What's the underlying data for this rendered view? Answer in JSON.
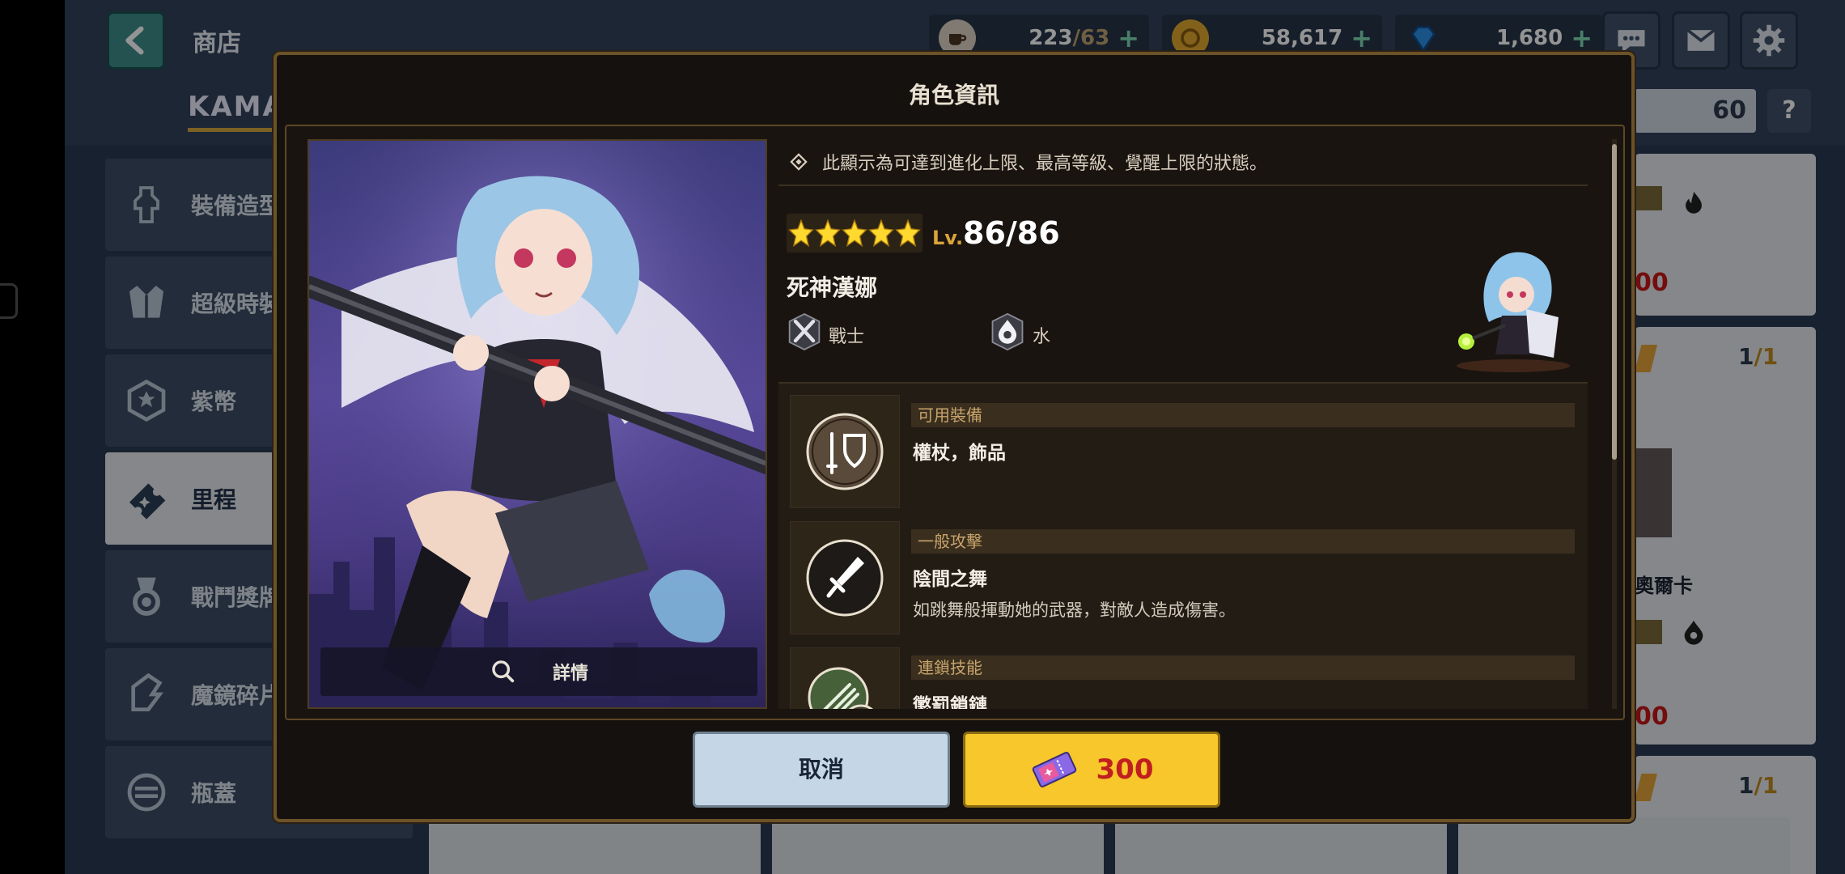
{
  "header": {
    "title": "商店",
    "tab_label": "KAMAZ",
    "ticket_count": "60",
    "help_label": "?"
  },
  "currencies": [
    {
      "name": "coffee",
      "icon": "coffee-cup-icon",
      "value": "223",
      "max": "/63"
    },
    {
      "name": "gold",
      "icon": "gold-coin-icon",
      "value": "58,617"
    },
    {
      "name": "gem",
      "icon": "blue-gem-icon",
      "value": "1,680"
    }
  ],
  "side_menu": [
    {
      "label": "裝備造型",
      "icon": "costume-icon"
    },
    {
      "label": "超級時裝",
      "icon": "suit-icon"
    },
    {
      "label": "紫幣",
      "icon": "purple-coin-icon"
    },
    {
      "label": "里程",
      "icon": "mileage-ticket-icon",
      "active": true
    },
    {
      "label": "戰鬥獎牌",
      "icon": "medal-icon"
    },
    {
      "label": "魔鏡碎片",
      "icon": "mirror-shard-icon"
    },
    {
      "label": "瓶蓋",
      "icon": "bottle-cap-icon"
    }
  ],
  "right_cards": {
    "price_1": "00",
    "count_1": "1",
    "count_1_max": "/1",
    "name_2": "奧爾卡",
    "price_2": "00",
    "count_2": "1",
    "count_2_max": "/1"
  },
  "dialog": {
    "title": "角色資訊",
    "notice": "此顯示為可達到進化上限、最高等級、覺醒上限的狀態。",
    "stars": 5,
    "lv_prefix": "Lv.",
    "lv_value": "86/86",
    "char_name": "死神漢娜",
    "class_label": "戰士",
    "element_label": "水",
    "detail_label": "詳情",
    "skills": [
      {
        "tag": "可用裝備",
        "name": "權杖，飾品",
        "desc": ""
      },
      {
        "tag": "一般攻擊",
        "name": "陰間之舞",
        "desc": "如跳舞般揮動她的武器，對敵人造成傷害。"
      },
      {
        "tag": "連鎖技能",
        "name": "懲罰鎖鏈",
        "desc": ""
      }
    ],
    "cancel_label": "取消",
    "price": "300"
  },
  "colors": {
    "accent_gold": "#f7c72b",
    "price_red": "#c11f1f",
    "dialog_bg": "#15110e",
    "border_bronze": "#6b5228"
  }
}
